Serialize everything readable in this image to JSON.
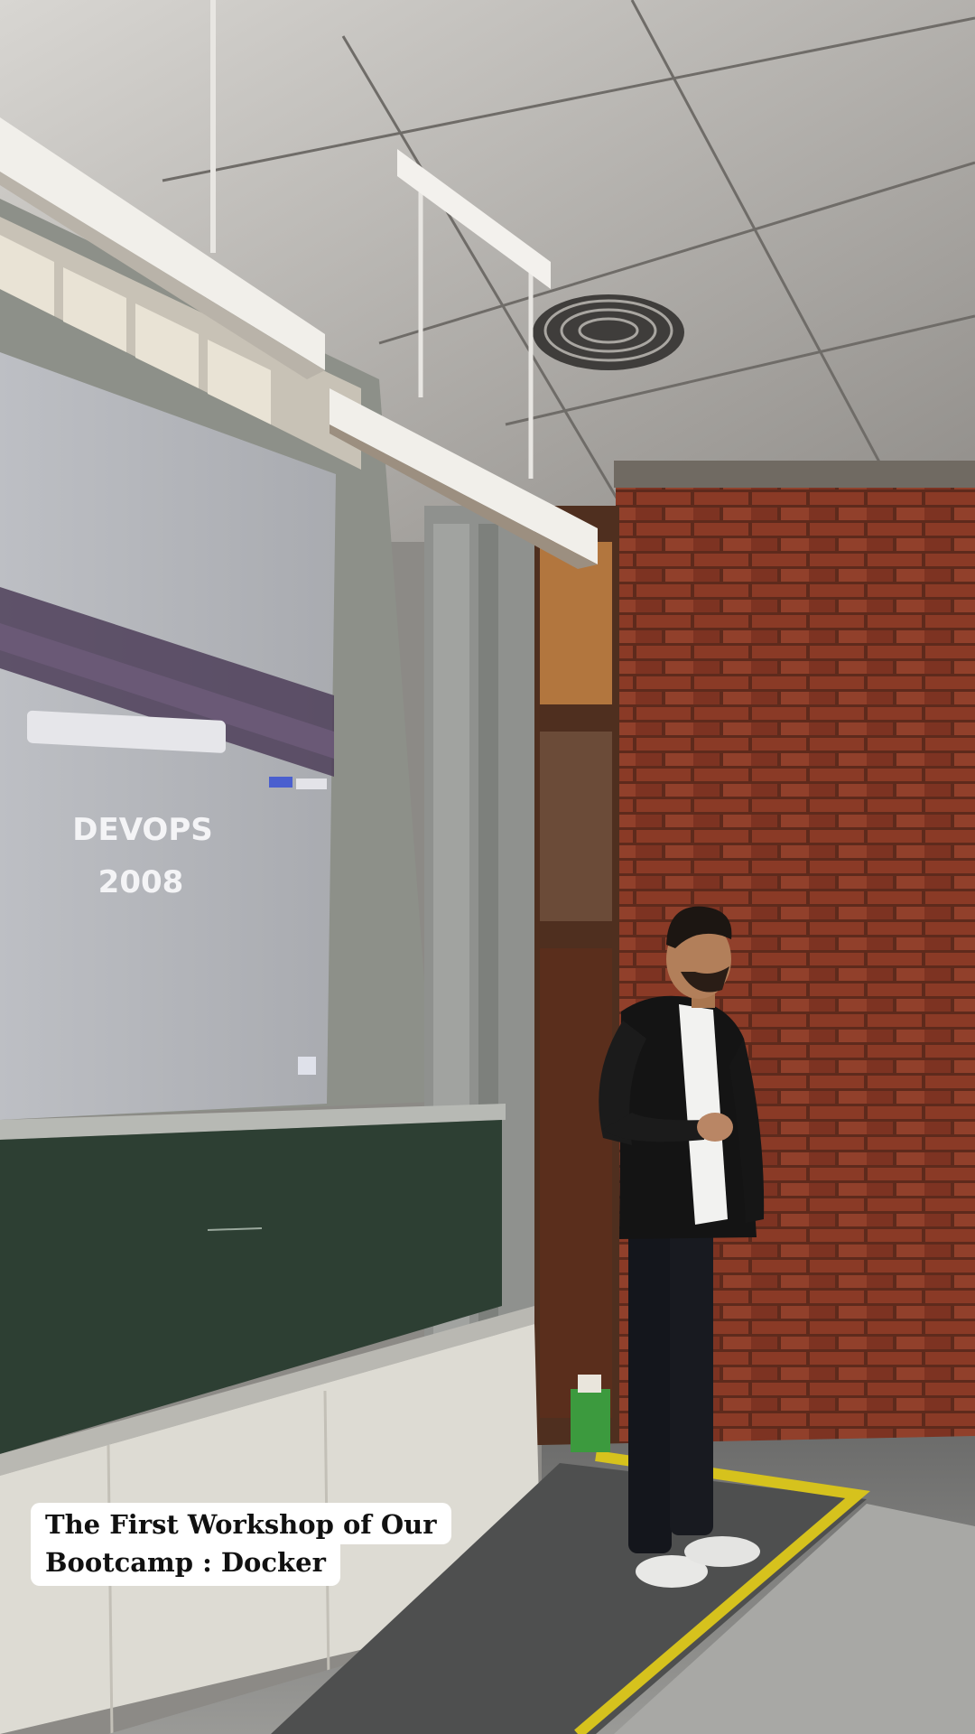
{
  "slide": {
    "line1": "DEVOPS",
    "line2": "2008"
  },
  "caption": {
    "line1": "The First Workshop of Our",
    "line2": "Bootcamp : Docker"
  }
}
